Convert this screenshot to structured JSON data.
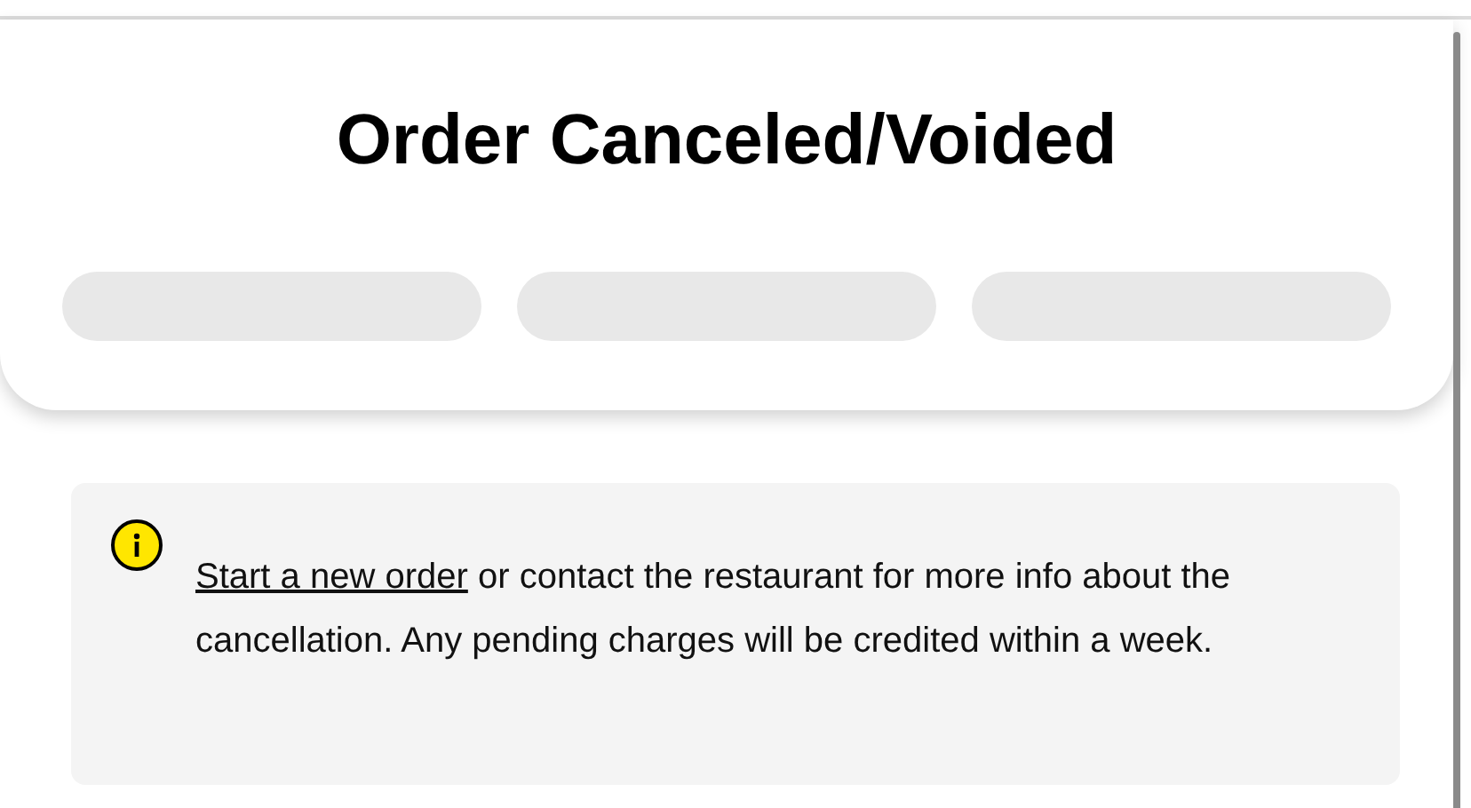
{
  "header": {
    "title": "Order Canceled/Voided",
    "placeholders": [
      {
        "kind": "skeleton"
      },
      {
        "kind": "skeleton"
      },
      {
        "kind": "skeleton"
      }
    ]
  },
  "notice": {
    "link": "Start a new order",
    "text": " or contact the restaurant for more info about the cancellation. Any pending charges will be credited within a week."
  }
}
